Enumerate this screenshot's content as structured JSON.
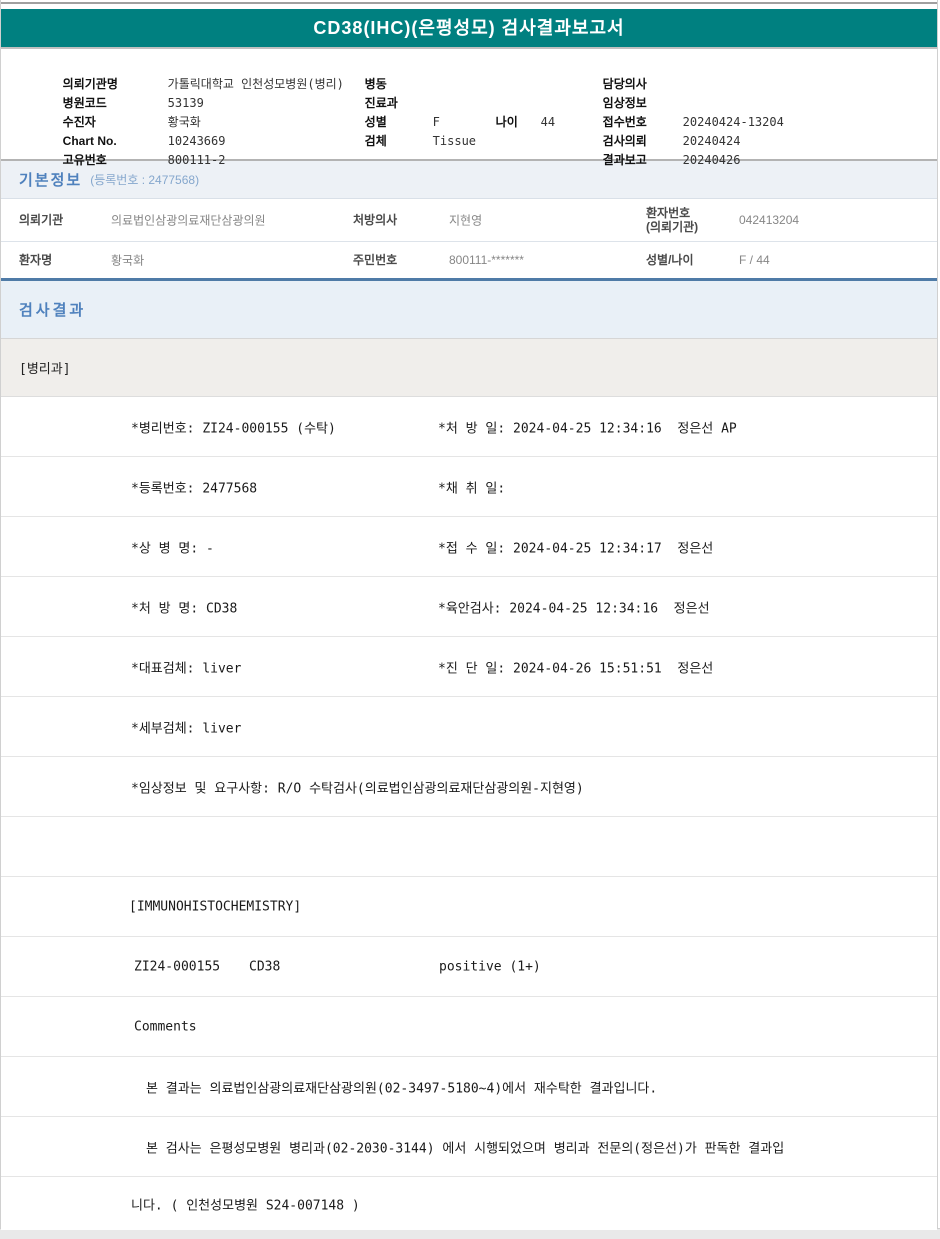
{
  "title": "CD38(IHC)(은평성모) 검사결과보고서",
  "colors": {
    "brand_teal": "#008080",
    "section_title_blue": "#4f81bd",
    "section_bg_blue": "#e9f0f7",
    "basic_info_bg": "#edf1f6",
    "dept_row_bg": "#f0eeeb",
    "thick_divider_blue": "#4f7ba7"
  },
  "patient_header": {
    "fields_left": [
      {
        "label": "의뢰기관명",
        "value": "가톨릭대학교 인천성모병원(병리)"
      },
      {
        "label": "병원코드",
        "value": "53139"
      },
      {
        "label": "수진자",
        "value": "황국화"
      },
      {
        "label": "Chart No.",
        "value": "10243669"
      },
      {
        "label": "고유번호",
        "value": "800111-2"
      }
    ],
    "fields_mid": [
      {
        "label": "병동",
        "value": ""
      },
      {
        "label": "진료과",
        "value": ""
      },
      {
        "label": "성별",
        "value": "F",
        "label2": "나이",
        "value2": "44"
      },
      {
        "label": "검체",
        "value": "Tissue"
      }
    ],
    "fields_right": [
      {
        "label": "담당의사",
        "value": ""
      },
      {
        "label": "임상정보",
        "value": ""
      },
      {
        "label": "접수번호",
        "value": "20240424-13204"
      },
      {
        "label": "검사의뢰",
        "value": "20240424"
      },
      {
        "label": "결과보고",
        "value": "20240426"
      }
    ]
  },
  "basic_info": {
    "section_title": "기본정보",
    "registration_note": "(등록번호 : 2477568)",
    "row1": {
      "c1_label": "의뢰기관",
      "c1_value": "의료법인삼광의료재단삼광의원",
      "c2_label": "처방의사",
      "c2_value": "지현영",
      "c3_label_line1": "환자번호",
      "c3_label_line2": "(의뢰기관)",
      "c3_value": "042413204"
    },
    "row2": {
      "c1_label": "환자명",
      "c1_value": "황국화",
      "c2_label": "주민번호",
      "c2_value": "800111-*******",
      "c3_label": "성별/나이",
      "c3_value": "F / 44"
    }
  },
  "results": {
    "section_title": "검사결과",
    "department": "[병리과]",
    "detail_rows": [
      {
        "left": "*병리번호: ZI24-000155 (수탁)",
        "right": "*처 방 일: 2024-04-25 12:34:16  정은선 AP"
      },
      {
        "left": "*등록번호: 2477568",
        "right": "*채 취 일:"
      },
      {
        "left": "*상 병 명: -",
        "right": "*접 수 일: 2024-04-25 12:34:17  정은선"
      },
      {
        "left": "*처 방 명: CD38",
        "right": "*육안검사: 2024-04-25 12:34:16  정은선"
      },
      {
        "left": "*대표검체: liver",
        "right": "*진 단 일: 2024-04-26 15:51:51  정은선"
      },
      {
        "left": "*세부검체: liver",
        "right": ""
      },
      {
        "left": "*임상정보 및 요구사항: R/O 수탁검사(의료법인삼광의료재단삼광의원-지현영)",
        "right": ""
      }
    ],
    "ihc_header": "[IMMUNOHISTOCHEMISTRY]",
    "ihc_row": {
      "pathology_no": "ZI24-000155",
      "test_name": "CD38",
      "result": "positive (1+)"
    },
    "comments_label": "Comments",
    "comment_lines": [
      "본 결과는 의료법인삼광의료재단삼광의원(02-3497-5180~4)에서 재수탁한 결과입니다.",
      "본 검사는 은평성모병원 병리과(02-2030-3144) 에서 시행되었으며 병리과 전문의(정은선)가 판독한 결과입",
      "니다. ( 인천성모병원 S24-007148 )"
    ]
  }
}
